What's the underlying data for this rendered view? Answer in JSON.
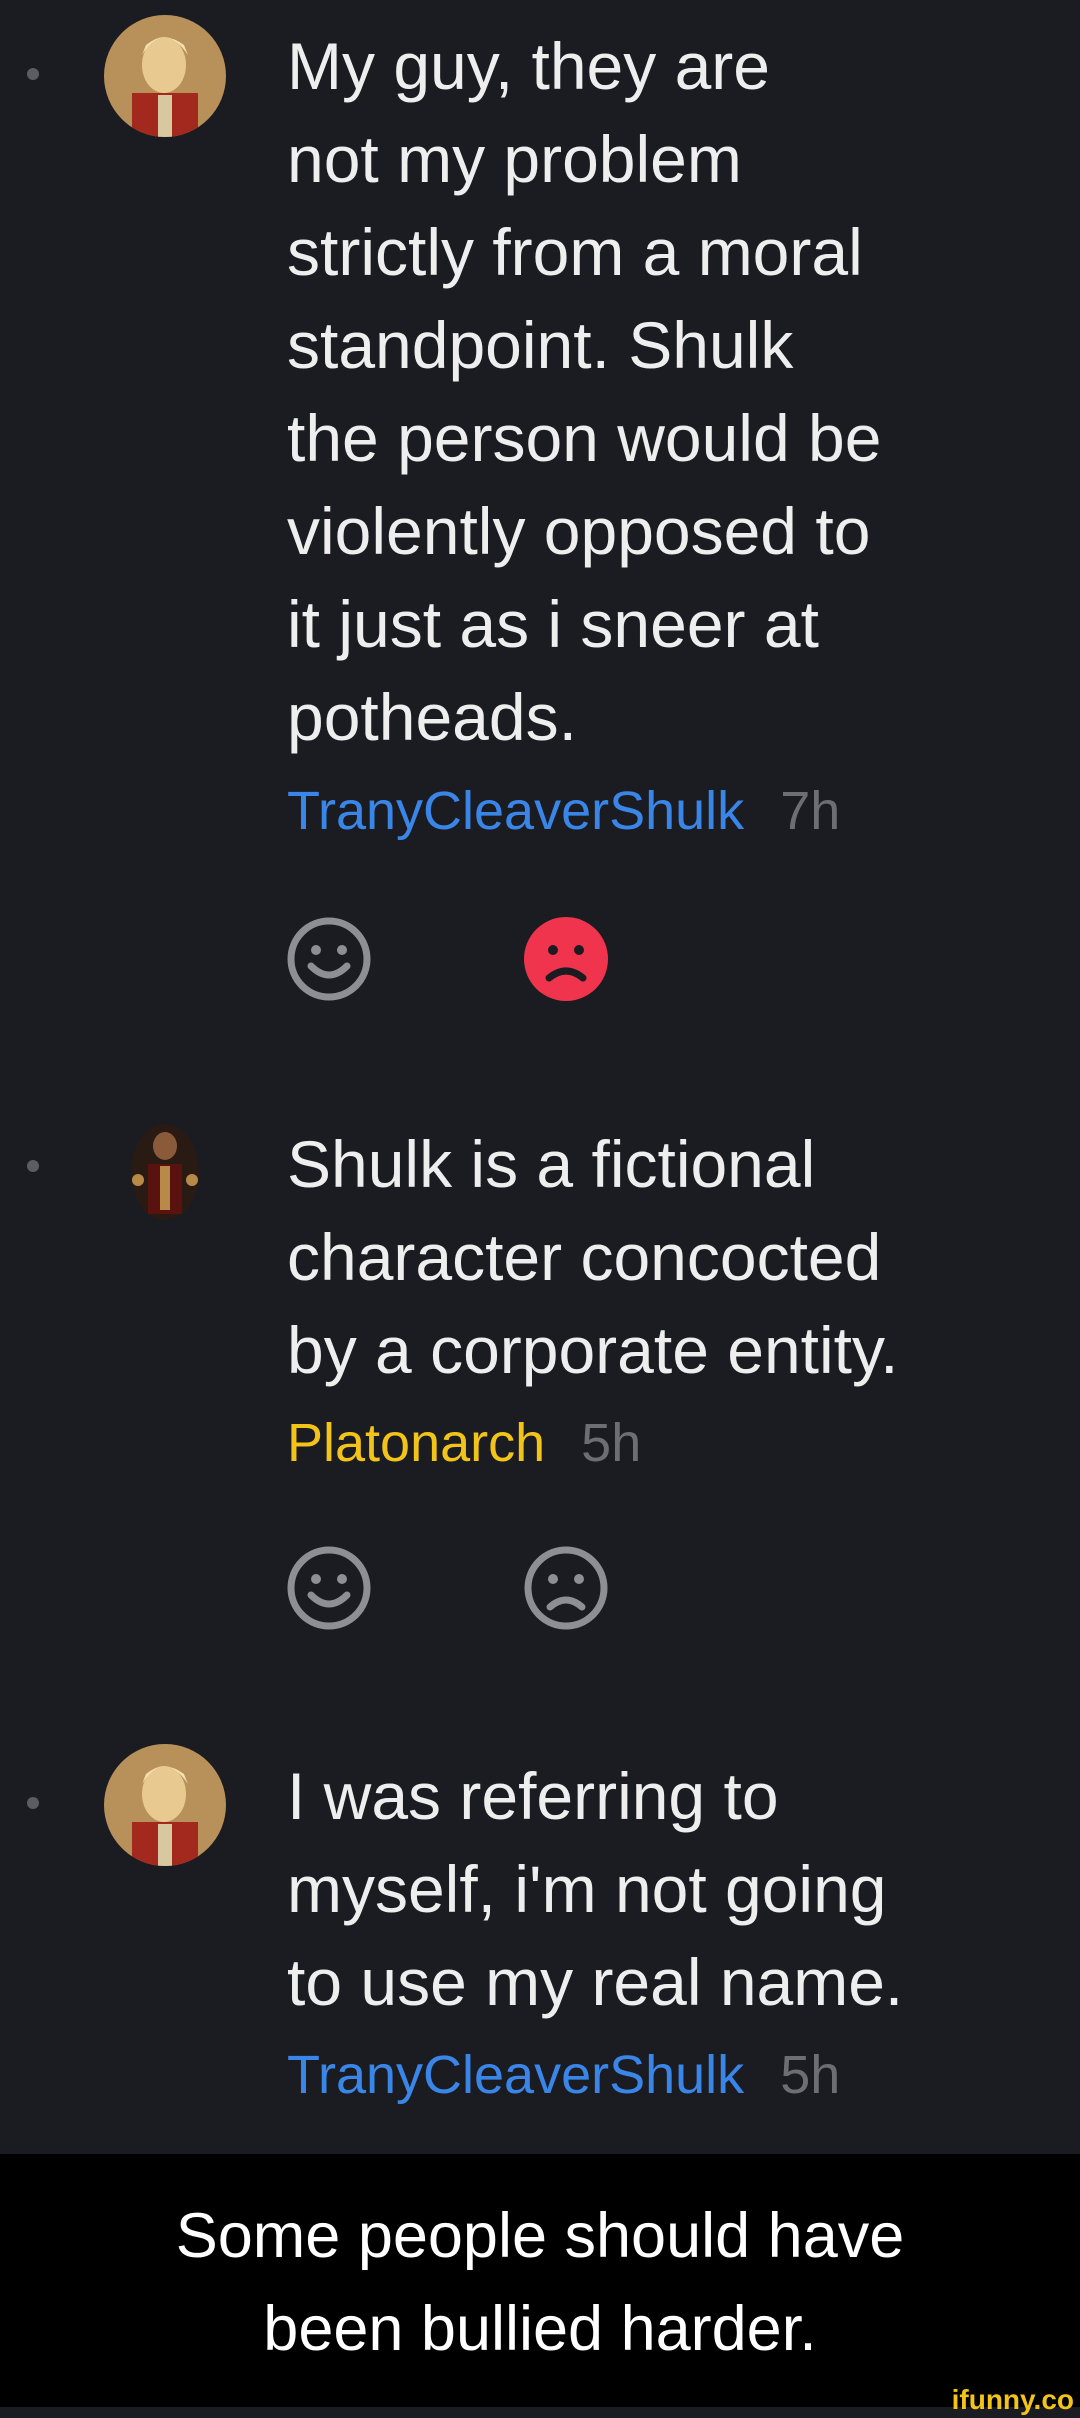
{
  "comments": [
    {
      "text": "My guy, they are\nnot my problem\nstrictly from a moral\nstandpoint. Shulk\nthe person would be\nviolently opposed to\nit just as i sneer at\npotheads.",
      "author": "TranyCleaverShulk",
      "time": "7h",
      "reactions": {
        "smile_active": false,
        "frown_active": true
      }
    },
    {
      "text": "Shulk is a fictional\ncharacter concocted\nby a corporate entity.",
      "author": "Platonarch",
      "time": "5h",
      "reactions": {
        "smile_active": false,
        "frown_active": false
      }
    },
    {
      "text": "I was referring to\nmyself, i'm not going\nto use my real name.",
      "author": "TranyCleaverShulk",
      "time": "5h"
    }
  ],
  "caption": "Some people should have\nbeen bullied harder.",
  "watermark": "ifunny.co",
  "colors": {
    "background": "#1b1c21",
    "author_blue": "#3a86e8",
    "author_gold": "#f2c318",
    "frown_active": "#f0344e"
  }
}
